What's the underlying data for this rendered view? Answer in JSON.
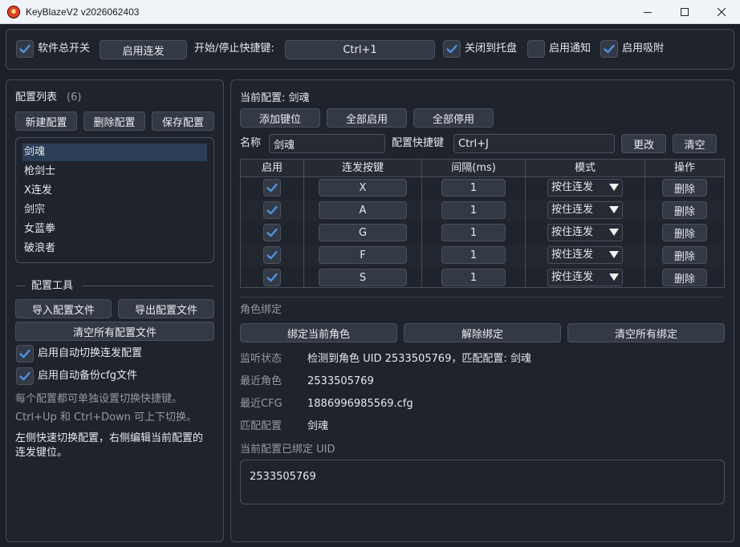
{
  "window": {
    "title": "KeyBlazeV2 v2026062403"
  },
  "topbar": {
    "master_switch_label": "软件总开关",
    "enable_burst_button": "启用连发",
    "hotkey_label": "开始/停止快捷键:",
    "hotkey_value": "Ctrl+1",
    "close_to_tray_label": "关闭到托盘",
    "enable_notify_label": "启用通知",
    "enable_snap_label": "启用吸附"
  },
  "left": {
    "config_list_title": "配置列表",
    "config_count": "(6)",
    "new_config": "新建配置",
    "delete_config": "删除配置",
    "save_config": "保存配置",
    "configs": [
      "剑魂",
      "枪剑士",
      "X连发",
      "剑宗",
      "女蓝拳",
      "破浪者"
    ],
    "selected_index": 0,
    "tools_title": "配置工具",
    "import_config": "导入配置文件",
    "export_config": "导出配置文件",
    "clear_all_configs": "清空所有配置文件",
    "auto_switch_label": "启用自动切换连发配置",
    "auto_backup_label": "启用自动备份cfg文件",
    "hint1": "每个配置都可单独设置切换快捷键。",
    "hint2": "Ctrl+Up 和 Ctrl+Down 可上下切换。",
    "hint3": "左侧快速切换配置，右侧编辑当前配置的",
    "hint3b": "连发键位。"
  },
  "right": {
    "current_config_label": "当前配置: 剑魂",
    "add_key": "添加键位",
    "enable_all": "全部启用",
    "disable_all": "全部停用",
    "name_label": "名称",
    "name_value": "剑魂",
    "config_hotkey_label": "配置快捷键",
    "config_hotkey_value": "Ctrl+J",
    "change_button": "更改",
    "clear_button": "清空",
    "table": {
      "headers": [
        "启用",
        "连发按键",
        "间隔(ms)",
        "模式",
        "操作"
      ],
      "rows": [
        {
          "enabled": true,
          "key": "X",
          "interval": "1",
          "mode": "按住连发",
          "action": "删除"
        },
        {
          "enabled": true,
          "key": "A",
          "interval": "1",
          "mode": "按住连发",
          "action": "删除"
        },
        {
          "enabled": true,
          "key": "G",
          "interval": "1",
          "mode": "按住连发",
          "action": "删除"
        },
        {
          "enabled": true,
          "key": "F",
          "interval": "1",
          "mode": "按住连发",
          "action": "删除"
        },
        {
          "enabled": true,
          "key": "S",
          "interval": "1",
          "mode": "按住连发",
          "action": "删除"
        }
      ]
    },
    "binding_title": "角色绑定",
    "bind_current": "绑定当前角色",
    "unbind": "解除绑定",
    "clear_all_bindings": "清空所有绑定",
    "info": [
      {
        "label": "监听状态",
        "value": "检测到角色 UID 2533505769，匹配配置: 剑魂"
      },
      {
        "label": "最近角色",
        "value": "2533505769"
      },
      {
        "label": "最近CFG",
        "value": "1886996985569.cfg"
      },
      {
        "label": "匹配配置",
        "value": "剑魂"
      }
    ],
    "bound_uid_label": "当前配置已绑定 UID",
    "bound_uid_value": "2533505769"
  },
  "colors": {
    "background": "#1c2029",
    "panel_border": "#474d59",
    "button": "#343946",
    "check_accent": "#4f93e6",
    "selection": "#2b3e58"
  }
}
